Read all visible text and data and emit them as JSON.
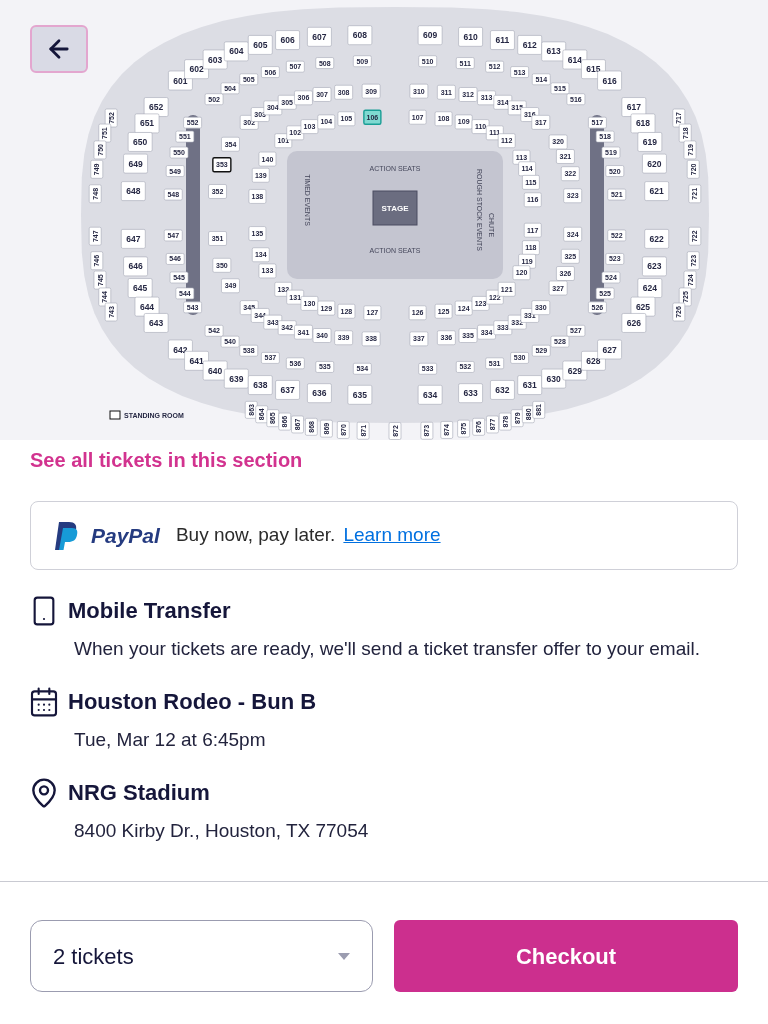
{
  "seat_map": {
    "rings": [
      {
        "top": [
          {
            "label": "101",
            "selected": false
          },
          {
            "label": "102",
            "selected": false
          },
          {
            "label": "103",
            "selected": false
          },
          {
            "label": "104",
            "selected": false
          },
          {
            "label": "105",
            "selected": false
          },
          {
            "label": "106",
            "selected": true
          },
          {
            "label": "107",
            "selected": false
          },
          {
            "label": "108",
            "selected": false
          },
          {
            "label": "109",
            "selected": false
          },
          {
            "label": "110",
            "selected": false
          },
          {
            "label": "111",
            "selected": false
          },
          {
            "label": "112",
            "selected": false
          }
        ],
        "left": [
          {
            "label": "140",
            "selected": false
          },
          {
            "label": "139",
            "selected": false
          },
          {
            "label": "138",
            "selected": false
          },
          {
            "label": "135",
            "selected": false
          },
          {
            "label": "134",
            "selected": false
          },
          {
            "label": "133",
            "selected": false
          }
        ],
        "right": [
          {
            "label": "113",
            "selected": false
          },
          {
            "label": "114",
            "selected": false
          },
          {
            "label": "115",
            "selected": false
          },
          {
            "label": "116",
            "selected": false
          },
          {
            "label": "117",
            "selected": false
          },
          {
            "label": "118",
            "selected": false
          },
          {
            "label": "119",
            "selected": false
          },
          {
            "label": "120",
            "selected": false
          }
        ],
        "bottom": [
          {
            "label": "132",
            "selected": false
          },
          {
            "label": "131",
            "selected": false
          },
          {
            "label": "130",
            "selected": false
          },
          {
            "label": "129",
            "selected": false
          },
          {
            "label": "128",
            "selected": false
          },
          {
            "label": "127",
            "selected": false
          },
          {
            "label": "126",
            "selected": false
          },
          {
            "label": "125",
            "selected": false
          },
          {
            "label": "124",
            "selected": false
          },
          {
            "label": "123",
            "selected": false
          },
          {
            "label": "122",
            "selected": false
          },
          {
            "label": "121",
            "selected": false
          }
        ]
      },
      {
        "top": [
          {
            "label": "302",
            "selected": false
          },
          {
            "label": "303",
            "selected": false
          },
          {
            "label": "304",
            "selected": false
          },
          {
            "label": "305",
            "selected": false
          },
          {
            "label": "306",
            "selected": false
          },
          {
            "label": "307",
            "selected": false
          },
          {
            "label": "308",
            "selected": false
          },
          {
            "label": "309",
            "selected": false
          },
          {
            "label": "310",
            "selected": false
          },
          {
            "label": "311",
            "selected": false
          },
          {
            "label": "312",
            "selected": false
          },
          {
            "label": "313",
            "selected": false
          },
          {
            "label": "314",
            "selected": false
          },
          {
            "label": "315",
            "selected": false
          },
          {
            "label": "316",
            "selected": false
          },
          {
            "label": "317",
            "selected": false
          }
        ],
        "left": [
          {
            "label": "354",
            "selected": false,
            "kind": "seat"
          },
          {
            "label": "353",
            "selected": false,
            "kind": "standing"
          },
          {
            "label": "352",
            "selected": false,
            "kind": "seat"
          },
          {
            "label": "351",
            "selected": false,
            "kind": "seat"
          },
          {
            "label": "350",
            "selected": false,
            "kind": "seat"
          },
          {
            "label": "349",
            "selected": false,
            "kind": "seat"
          }
        ],
        "right": [
          {
            "label": "320",
            "selected": false
          },
          {
            "label": "321",
            "selected": false
          },
          {
            "label": "322",
            "selected": false
          },
          {
            "label": "323",
            "selected": false
          },
          {
            "label": "324",
            "selected": false
          },
          {
            "label": "325",
            "selected": false
          },
          {
            "label": "326",
            "selected": false
          },
          {
            "label": "327",
            "selected": false
          }
        ],
        "bottom": [
          {
            "label": "345",
            "selected": false
          },
          {
            "label": "344",
            "selected": false
          },
          {
            "label": "343",
            "selected": false
          },
          {
            "label": "342",
            "selected": false
          },
          {
            "label": "341",
            "selected": false
          },
          {
            "label": "340",
            "selected": false
          },
          {
            "label": "339",
            "selected": false
          },
          {
            "label": "338",
            "selected": false
          },
          {
            "label": "337",
            "selected": false
          },
          {
            "label": "336",
            "selected": false
          },
          {
            "label": "335",
            "selected": false
          },
          {
            "label": "334",
            "selected": false
          },
          {
            "label": "333",
            "selected": false
          },
          {
            "label": "332",
            "selected": false
          },
          {
            "label": "331",
            "selected": false
          },
          {
            "label": "330",
            "selected": false
          }
        ]
      },
      {
        "top": [
          {
            "label": "502",
            "selected": false
          },
          {
            "label": "504",
            "selected": false
          },
          {
            "label": "505",
            "selected": false
          },
          {
            "label": "506",
            "selected": false
          },
          {
            "label": "507",
            "selected": false
          },
          {
            "label": "508",
            "selected": false
          },
          {
            "label": "509",
            "selected": false
          },
          {
            "label": "510",
            "selected": false
          },
          {
            "label": "511",
            "selected": false
          },
          {
            "label": "512",
            "selected": false
          },
          {
            "label": "513",
            "selected": false
          },
          {
            "label": "514",
            "selected": false
          },
          {
            "label": "515",
            "selected": false
          },
          {
            "label": "516",
            "selected": false
          }
        ],
        "left": [
          {
            "label": "552",
            "selected": false
          },
          {
            "label": "551",
            "selected": false
          },
          {
            "label": "550",
            "selected": false
          },
          {
            "label": "549",
            "selected": false
          },
          {
            "label": "548",
            "selected": false
          },
          {
            "label": "547",
            "selected": false
          },
          {
            "label": "546",
            "selected": false
          },
          {
            "label": "545",
            "selected": false
          },
          {
            "label": "544",
            "selected": false
          },
          {
            "label": "543",
            "selected": false
          }
        ],
        "right": [
          {
            "label": "517",
            "selected": false
          },
          {
            "label": "518",
            "selected": false
          },
          {
            "label": "519",
            "selected": false
          },
          {
            "label": "520",
            "selected": false
          },
          {
            "label": "521",
            "selected": false
          },
          {
            "label": "522",
            "selected": false
          },
          {
            "label": "523",
            "selected": false
          },
          {
            "label": "524",
            "selected": false
          },
          {
            "label": "525",
            "selected": false
          },
          {
            "label": "526",
            "selected": false
          }
        ],
        "bottom": [
          {
            "label": "542",
            "selected": false
          },
          {
            "label": "540",
            "selected": false
          },
          {
            "label": "538",
            "selected": false
          },
          {
            "label": "537",
            "selected": false
          },
          {
            "label": "536",
            "selected": false
          },
          {
            "label": "535",
            "selected": false
          },
          {
            "label": "534",
            "selected": false
          },
          {
            "label": "533",
            "selected": false
          },
          {
            "label": "532",
            "selected": false
          },
          {
            "label": "531",
            "selected": false
          },
          {
            "label": "530",
            "selected": false
          },
          {
            "label": "529",
            "selected": false
          },
          {
            "label": "528",
            "selected": false
          },
          {
            "label": "527",
            "selected": false
          }
        ]
      },
      {
        "top": [
          {
            "label": "601",
            "selected": false
          },
          {
            "label": "602",
            "selected": false
          },
          {
            "label": "603",
            "selected": false
          },
          {
            "label": "604",
            "selected": false
          },
          {
            "label": "605",
            "selected": false
          },
          {
            "label": "606",
            "selected": false
          },
          {
            "label": "607",
            "selected": false
          },
          {
            "label": "608",
            "selected": false
          },
          {
            "label": "609",
            "selected": false
          },
          {
            "label": "610",
            "selected": false
          },
          {
            "label": "611",
            "selected": false
          },
          {
            "label": "612",
            "selected": false
          },
          {
            "label": "613",
            "selected": false
          },
          {
            "label": "614",
            "selected": false
          },
          {
            "label": "615",
            "selected": false
          },
          {
            "label": "616",
            "selected": false
          }
        ],
        "left": [
          {
            "label": "652",
            "selected": false
          },
          {
            "label": "651",
            "selected": false
          },
          {
            "label": "650",
            "selected": false
          },
          {
            "label": "649",
            "selected": false
          },
          {
            "label": "648",
            "selected": false
          },
          {
            "label": "647",
            "selected": false
          },
          {
            "label": "646",
            "selected": false
          },
          {
            "label": "645",
            "selected": false
          },
          {
            "label": "644",
            "selected": false
          },
          {
            "label": "643",
            "selected": false
          }
        ],
        "right": [
          {
            "label": "617",
            "selected": false
          },
          {
            "label": "618",
            "selected": false
          },
          {
            "label": "619",
            "selected": false
          },
          {
            "label": "620",
            "selected": false
          },
          {
            "label": "621",
            "selected": false
          },
          {
            "label": "622",
            "selected": false
          },
          {
            "label": "623",
            "selected": false
          },
          {
            "label": "624",
            "selected": false
          },
          {
            "label": "625",
            "selected": false
          },
          {
            "label": "626",
            "selected": false
          }
        ],
        "bottom": [
          {
            "label": "642",
            "selected": false
          },
          {
            "label": "641",
            "selected": false
          },
          {
            "label": "640",
            "selected": false
          },
          {
            "label": "639",
            "selected": false
          },
          {
            "label": "638",
            "selected": false
          },
          {
            "label": "637",
            "selected": false
          },
          {
            "label": "636",
            "selected": false
          },
          {
            "label": "635",
            "selected": false
          },
          {
            "label": "634",
            "selected": false
          },
          {
            "label": "633",
            "selected": false
          },
          {
            "label": "632",
            "selected": false
          },
          {
            "label": "631",
            "selected": false
          },
          {
            "label": "630",
            "selected": false
          },
          {
            "label": "629",
            "selected": false
          },
          {
            "label": "628",
            "selected": false
          },
          {
            "label": "627",
            "selected": false
          }
        ]
      },
      {
        "left": [
          {
            "label": "752",
            "selected": false
          },
          {
            "label": "751",
            "selected": false
          },
          {
            "label": "750",
            "selected": false
          },
          {
            "label": "749",
            "selected": false
          },
          {
            "label": "748",
            "selected": false
          },
          {
            "label": "747",
            "selected": false
          },
          {
            "label": "746",
            "selected": false
          },
          {
            "label": "745",
            "selected": false
          },
          {
            "label": "744",
            "selected": false
          },
          {
            "label": "743",
            "selected": false
          }
        ],
        "right": [
          {
            "label": "717",
            "selected": false
          },
          {
            "label": "718",
            "selected": false
          },
          {
            "label": "719",
            "selected": false
          },
          {
            "label": "720",
            "selected": false
          },
          {
            "label": "721",
            "selected": false
          },
          {
            "label": "722",
            "selected": false
          },
          {
            "label": "723",
            "selected": false
          },
          {
            "label": "724",
            "selected": false
          },
          {
            "label": "725",
            "selected": false
          },
          {
            "label": "726",
            "selected": false
          }
        ]
      },
      {
        "bottom": [
          {
            "label": "863",
            "selected": false
          },
          {
            "label": "864",
            "selected": false
          },
          {
            "label": "865",
            "selected": false
          },
          {
            "label": "866",
            "selected": false
          },
          {
            "label": "867",
            "selected": false
          },
          {
            "label": "868",
            "selected": false
          },
          {
            "label": "869",
            "selected": false
          },
          {
            "label": "870",
            "selected": false
          },
          {
            "label": "871",
            "selected": false
          },
          {
            "label": "872",
            "selected": false
          },
          {
            "label": "873",
            "selected": false
          },
          {
            "label": "874",
            "selected": false
          },
          {
            "label": "875",
            "selected": false
          },
          {
            "label": "876",
            "selected": false
          },
          {
            "label": "877",
            "selected": false
          },
          {
            "label": "878",
            "selected": false
          },
          {
            "label": "879",
            "selected": false
          },
          {
            "label": "880",
            "selected": false
          },
          {
            "label": "881",
            "selected": false
          }
        ]
      }
    ],
    "stage": "STAGE",
    "action_seats": [
      "ACTION SEATS",
      "ACTION SEATS"
    ],
    "timed_events": "TIMED EVENTS",
    "rough_stock_events": "ROUGH STOCK EVENTS",
    "chute": "CHUTE",
    "legend": "STANDING ROOM"
  },
  "section_link": "See all tickets in this section",
  "paypal": {
    "brand": "PayPal",
    "message": "Buy now, pay later.",
    "link": "Learn more"
  },
  "details": [
    {
      "kind": "delivery",
      "title": "Mobile Transfer",
      "text": "When your tickets are ready, we'll send a ticket transfer offer to your email."
    },
    {
      "kind": "event",
      "title": "Houston Rodeo - Bun B",
      "text": "Tue, Mar 12 at 6:45pm"
    },
    {
      "kind": "venue",
      "title": "NRG Stadium",
      "text": "8400 Kirby Dr., Houston, TX 77054"
    }
  ],
  "quantity": {
    "value": "2 tickets"
  },
  "checkout_button": "Checkout"
}
